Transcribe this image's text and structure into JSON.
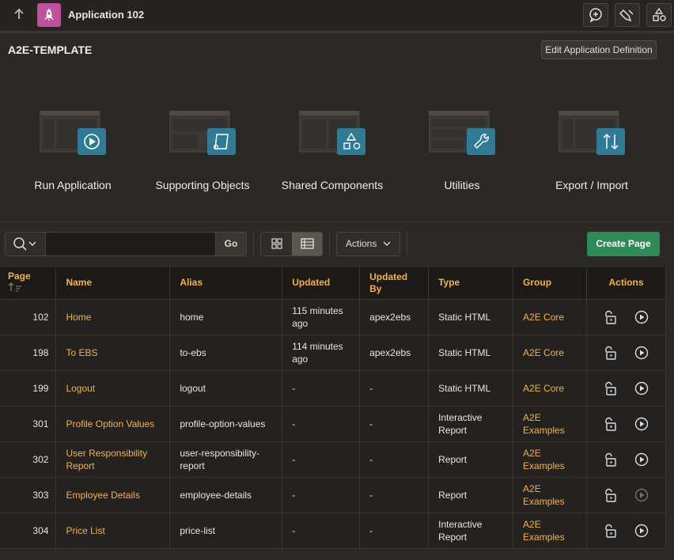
{
  "topbar": {
    "app_title": "Application 102"
  },
  "heading": "A2E-TEMPLATE",
  "edit_button": "Edit Application Definition",
  "tiles": [
    {
      "label": "Run Application",
      "icon": "play-icon"
    },
    {
      "label": "Supporting Objects",
      "icon": "scroll-icon"
    },
    {
      "label": "Shared Components",
      "icon": "shapes-icon"
    },
    {
      "label": "Utilities",
      "icon": "wrench-icon"
    },
    {
      "label": "Export / Import",
      "icon": "arrows-updown-icon"
    }
  ],
  "toolbar": {
    "search_placeholder": "",
    "go_label": "Go",
    "actions_label": "Actions",
    "create_label": "Create Page"
  },
  "table": {
    "headers": [
      "Page",
      "Name",
      "Alias",
      "Updated",
      "Updated By",
      "Type",
      "Group",
      "Actions"
    ],
    "rows": [
      {
        "page": "102",
        "name": "Home",
        "alias": "home",
        "updated": "115 minutes ago",
        "by": "apex2ebs",
        "type": "Static HTML",
        "group": "A2E Core"
      },
      {
        "page": "198",
        "name": "To EBS",
        "alias": "to-ebs",
        "updated": "114 minutes ago",
        "by": "apex2ebs",
        "type": "Static HTML",
        "group": "A2E Core"
      },
      {
        "page": "199",
        "name": "Logout",
        "alias": "logout",
        "updated": "-",
        "by": "-",
        "type": "Static HTML",
        "group": "A2E Core"
      },
      {
        "page": "301",
        "name": "Profile Option Values",
        "alias": "profile-option-values",
        "updated": "-",
        "by": "-",
        "type": "Interactive Report",
        "group": "A2E Examples"
      },
      {
        "page": "302",
        "name": "User Responsibility Report",
        "alias": "user-responsibility-report",
        "updated": "-",
        "by": "-",
        "type": "Report",
        "group": "A2E Examples"
      },
      {
        "page": "303",
        "name": "Employee Details",
        "alias": "employee-details",
        "updated": "-",
        "by": "-",
        "type": "Report",
        "group": "A2E Examples"
      },
      {
        "page": "304",
        "name": "Price List",
        "alias": "price-list",
        "updated": "-",
        "by": "-",
        "type": "Interactive Report",
        "group": "A2E Examples"
      }
    ]
  }
}
